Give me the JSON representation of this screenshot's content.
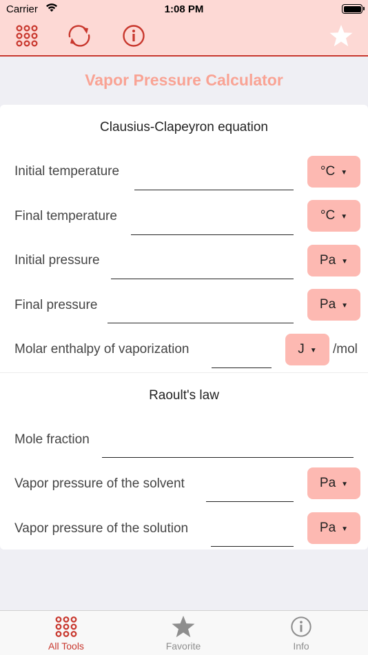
{
  "status_bar": {
    "carrier": "Carrier",
    "time": "1:08 PM"
  },
  "toolbar": {
    "icons": [
      "grid-icon",
      "refresh-icon",
      "info-icon",
      "star-icon"
    ],
    "accent_color": "#c8372d"
  },
  "title": "Vapor Pressure Calculator",
  "clausius": {
    "heading": "Clausius-Clapeyron equation",
    "rows": [
      {
        "label": "Initial temperature",
        "value": "",
        "unit": "°C"
      },
      {
        "label": "Final temperature",
        "value": "",
        "unit": "°C"
      },
      {
        "label": "Initial pressure",
        "value": "",
        "unit": "Pa"
      },
      {
        "label": "Final pressure",
        "value": "",
        "unit": "Pa"
      },
      {
        "label": "Molar enthalpy of vaporization",
        "value": "",
        "unit": "J",
        "suffix": "/mol"
      }
    ]
  },
  "raoult": {
    "heading": "Raoult's law",
    "rows": [
      {
        "label": "Mole fraction",
        "value": ""
      },
      {
        "label": "Vapor pressure of the solvent",
        "value": "",
        "unit": "Pa"
      },
      {
        "label": "Vapor pressure of the solution",
        "value": "",
        "unit": "Pa"
      }
    ]
  },
  "tabbar": {
    "tabs": [
      {
        "label": "All Tools",
        "icon": "grid-icon",
        "active": true
      },
      {
        "label": "Favorite",
        "icon": "star-icon",
        "active": false
      },
      {
        "label": "Info",
        "icon": "info-icon",
        "active": false
      }
    ],
    "active_color": "#c8372d",
    "inactive_color": "#8e8e8e"
  }
}
